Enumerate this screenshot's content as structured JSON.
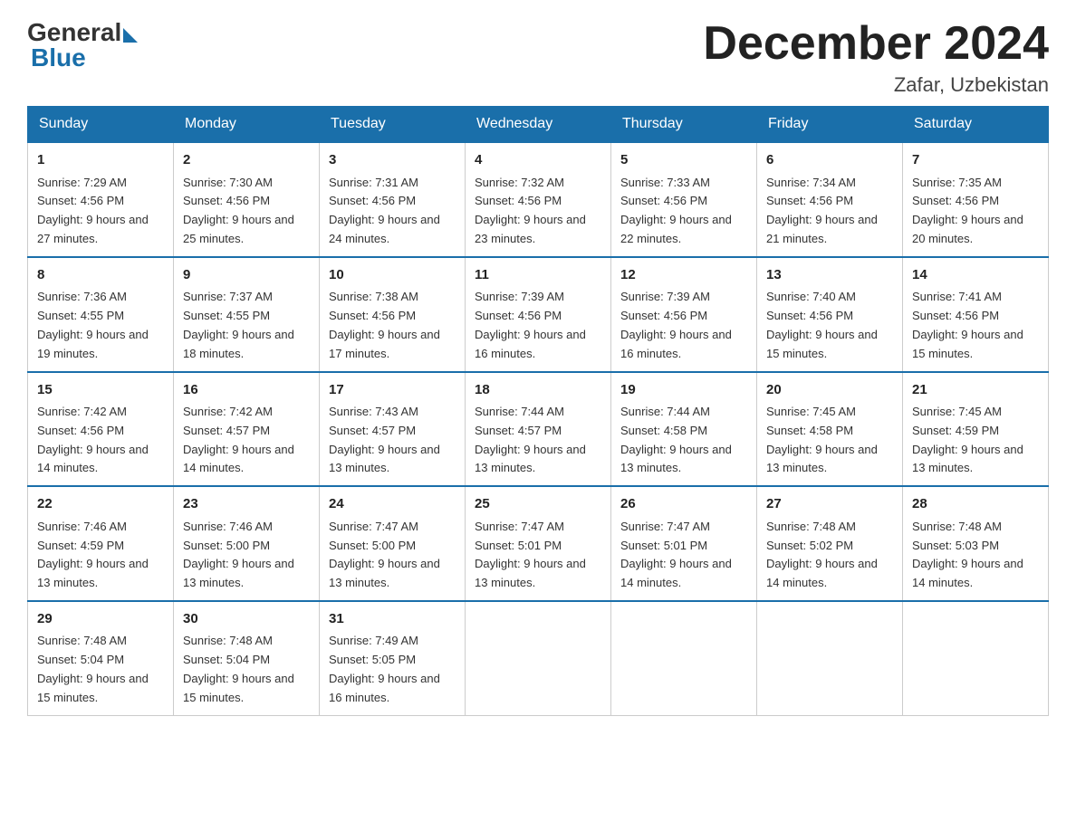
{
  "logo": {
    "general": "General",
    "blue": "Blue"
  },
  "title": "December 2024",
  "location": "Zafar, Uzbekistan",
  "days_of_week": [
    "Sunday",
    "Monday",
    "Tuesday",
    "Wednesday",
    "Thursday",
    "Friday",
    "Saturday"
  ],
  "weeks": [
    [
      {
        "day": "1",
        "sunrise": "7:29 AM",
        "sunset": "4:56 PM",
        "daylight": "9 hours and 27 minutes."
      },
      {
        "day": "2",
        "sunrise": "7:30 AM",
        "sunset": "4:56 PM",
        "daylight": "9 hours and 25 minutes."
      },
      {
        "day": "3",
        "sunrise": "7:31 AM",
        "sunset": "4:56 PM",
        "daylight": "9 hours and 24 minutes."
      },
      {
        "day": "4",
        "sunrise": "7:32 AM",
        "sunset": "4:56 PM",
        "daylight": "9 hours and 23 minutes."
      },
      {
        "day": "5",
        "sunrise": "7:33 AM",
        "sunset": "4:56 PM",
        "daylight": "9 hours and 22 minutes."
      },
      {
        "day": "6",
        "sunrise": "7:34 AM",
        "sunset": "4:56 PM",
        "daylight": "9 hours and 21 minutes."
      },
      {
        "day": "7",
        "sunrise": "7:35 AM",
        "sunset": "4:56 PM",
        "daylight": "9 hours and 20 minutes."
      }
    ],
    [
      {
        "day": "8",
        "sunrise": "7:36 AM",
        "sunset": "4:55 PM",
        "daylight": "9 hours and 19 minutes."
      },
      {
        "day": "9",
        "sunrise": "7:37 AM",
        "sunset": "4:55 PM",
        "daylight": "9 hours and 18 minutes."
      },
      {
        "day": "10",
        "sunrise": "7:38 AM",
        "sunset": "4:56 PM",
        "daylight": "9 hours and 17 minutes."
      },
      {
        "day": "11",
        "sunrise": "7:39 AM",
        "sunset": "4:56 PM",
        "daylight": "9 hours and 16 minutes."
      },
      {
        "day": "12",
        "sunrise": "7:39 AM",
        "sunset": "4:56 PM",
        "daylight": "9 hours and 16 minutes."
      },
      {
        "day": "13",
        "sunrise": "7:40 AM",
        "sunset": "4:56 PM",
        "daylight": "9 hours and 15 minutes."
      },
      {
        "day": "14",
        "sunrise": "7:41 AM",
        "sunset": "4:56 PM",
        "daylight": "9 hours and 15 minutes."
      }
    ],
    [
      {
        "day": "15",
        "sunrise": "7:42 AM",
        "sunset": "4:56 PM",
        "daylight": "9 hours and 14 minutes."
      },
      {
        "day": "16",
        "sunrise": "7:42 AM",
        "sunset": "4:57 PM",
        "daylight": "9 hours and 14 minutes."
      },
      {
        "day": "17",
        "sunrise": "7:43 AM",
        "sunset": "4:57 PM",
        "daylight": "9 hours and 13 minutes."
      },
      {
        "day": "18",
        "sunrise": "7:44 AM",
        "sunset": "4:57 PM",
        "daylight": "9 hours and 13 minutes."
      },
      {
        "day": "19",
        "sunrise": "7:44 AM",
        "sunset": "4:58 PM",
        "daylight": "9 hours and 13 minutes."
      },
      {
        "day": "20",
        "sunrise": "7:45 AM",
        "sunset": "4:58 PM",
        "daylight": "9 hours and 13 minutes."
      },
      {
        "day": "21",
        "sunrise": "7:45 AM",
        "sunset": "4:59 PM",
        "daylight": "9 hours and 13 minutes."
      }
    ],
    [
      {
        "day": "22",
        "sunrise": "7:46 AM",
        "sunset": "4:59 PM",
        "daylight": "9 hours and 13 minutes."
      },
      {
        "day": "23",
        "sunrise": "7:46 AM",
        "sunset": "5:00 PM",
        "daylight": "9 hours and 13 minutes."
      },
      {
        "day": "24",
        "sunrise": "7:47 AM",
        "sunset": "5:00 PM",
        "daylight": "9 hours and 13 minutes."
      },
      {
        "day": "25",
        "sunrise": "7:47 AM",
        "sunset": "5:01 PM",
        "daylight": "9 hours and 13 minutes."
      },
      {
        "day": "26",
        "sunrise": "7:47 AM",
        "sunset": "5:01 PM",
        "daylight": "9 hours and 14 minutes."
      },
      {
        "day": "27",
        "sunrise": "7:48 AM",
        "sunset": "5:02 PM",
        "daylight": "9 hours and 14 minutes."
      },
      {
        "day": "28",
        "sunrise": "7:48 AM",
        "sunset": "5:03 PM",
        "daylight": "9 hours and 14 minutes."
      }
    ],
    [
      {
        "day": "29",
        "sunrise": "7:48 AM",
        "sunset": "5:04 PM",
        "daylight": "9 hours and 15 minutes."
      },
      {
        "day": "30",
        "sunrise": "7:48 AM",
        "sunset": "5:04 PM",
        "daylight": "9 hours and 15 minutes."
      },
      {
        "day": "31",
        "sunrise": "7:49 AM",
        "sunset": "5:05 PM",
        "daylight": "9 hours and 16 minutes."
      },
      null,
      null,
      null,
      null
    ]
  ],
  "labels": {
    "sunrise": "Sunrise:",
    "sunset": "Sunset:",
    "daylight": "Daylight:"
  }
}
